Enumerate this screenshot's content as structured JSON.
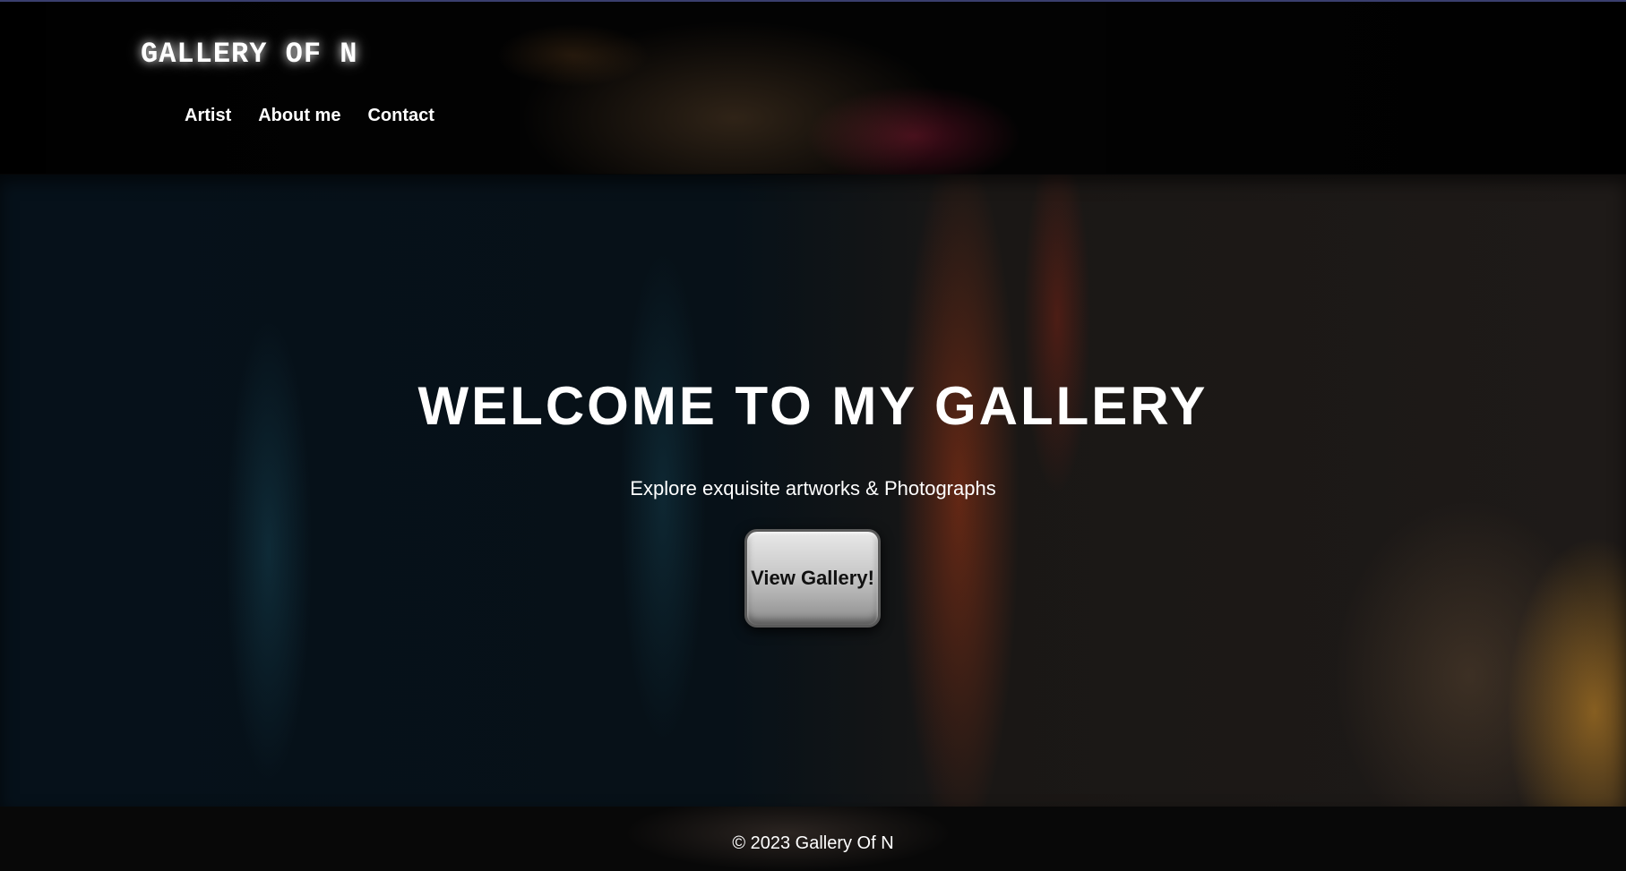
{
  "header": {
    "logo": "GALLERY OF N",
    "nav": [
      {
        "label": "Artist"
      },
      {
        "label": "About me"
      },
      {
        "label": "Contact"
      }
    ]
  },
  "hero": {
    "title": "WELCOME TO MY GALLERY",
    "subtitle": "Explore exquisite artworks & Photographs",
    "button_label": "View Gallery!"
  },
  "footer": {
    "copyright": "© 2023 Gallery Of N"
  },
  "colors": {
    "text": "#ffffff",
    "background": "#050505",
    "button_text": "#111111"
  }
}
